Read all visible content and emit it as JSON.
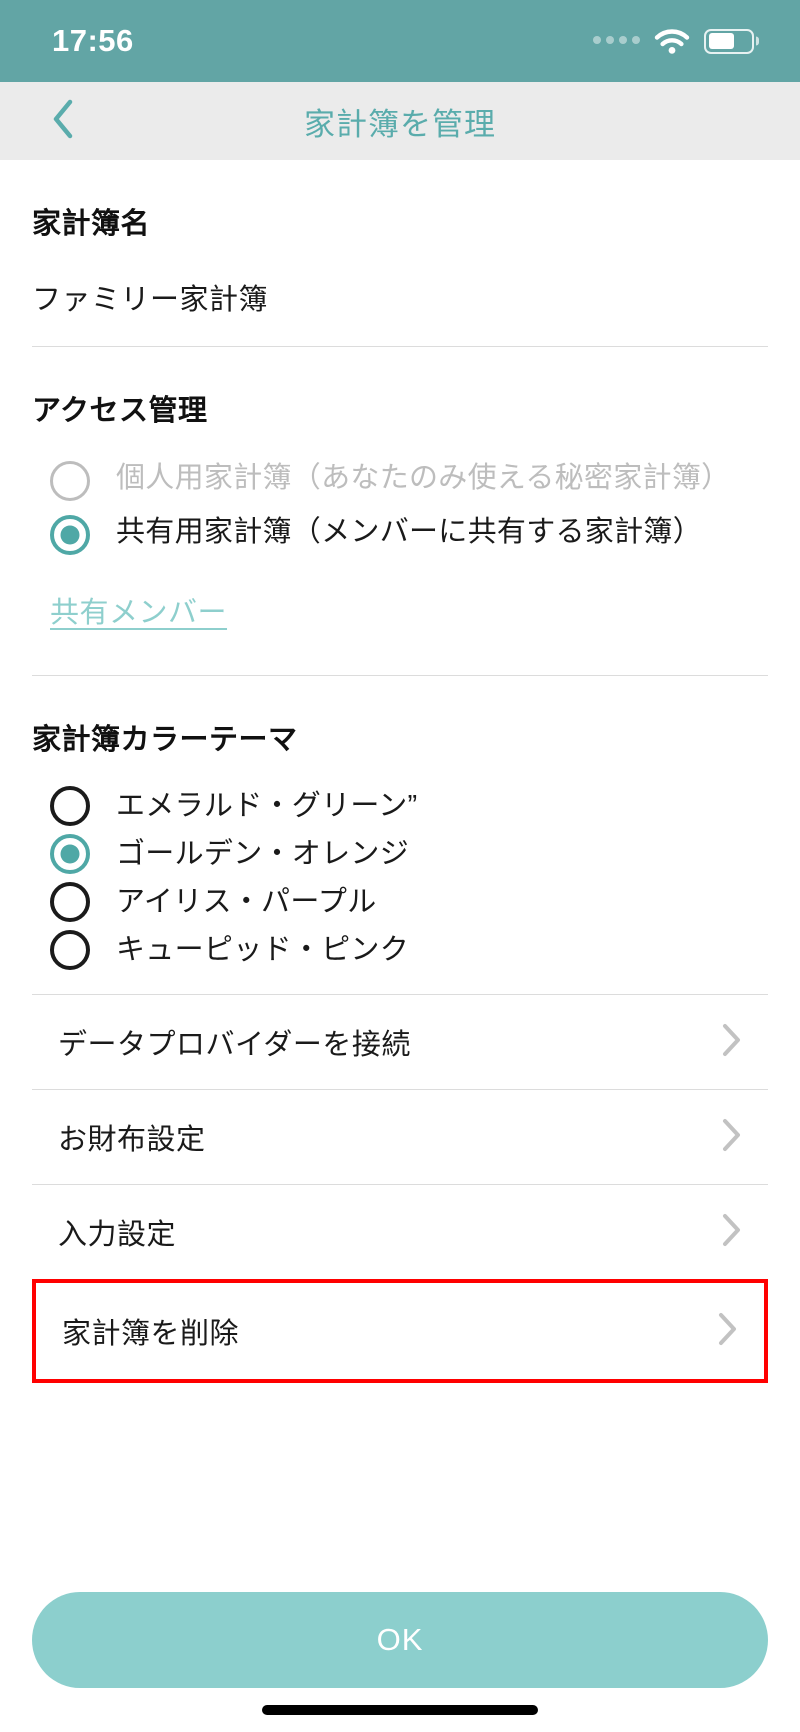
{
  "status_bar": {
    "time": "17:56",
    "signal_icon": "signal-dots-icon",
    "wifi_icon": "wifi-icon",
    "battery_icon": "battery-icon"
  },
  "nav": {
    "back_icon": "chevron-left-icon",
    "title": "家計簿を管理"
  },
  "name_section": {
    "label": "家計簿名",
    "value": "ファミリー家計簿"
  },
  "access_section": {
    "label": "アクセス管理",
    "options": [
      {
        "label": "個人用家計簿（あなたのみ使える秘密家計簿）",
        "selected": false,
        "disabled": true
      },
      {
        "label": "共有用家計簿（メンバーに共有する家計簿）",
        "selected": true,
        "disabled": false
      }
    ],
    "members_link": "共有メンバー"
  },
  "theme_section": {
    "label": "家計簿カラーテーマ",
    "options": [
      {
        "label": "エメラルド・グリーン”",
        "selected": false
      },
      {
        "label": "ゴールデン・オレンジ",
        "selected": true
      },
      {
        "label": "アイリス・パープル",
        "selected": false
      },
      {
        "label": "キューピッド・ピンク",
        "selected": false
      }
    ]
  },
  "list_rows": [
    {
      "label": "データプロバイダーを接続",
      "chevron": "chevron-right-icon",
      "highlighted": false
    },
    {
      "label": "お財布設定",
      "chevron": "chevron-right-icon",
      "highlighted": false
    },
    {
      "label": "入力設定",
      "chevron": "chevron-right-icon",
      "highlighted": false
    },
    {
      "label": "家計簿を削除",
      "chevron": "chevron-right-icon",
      "highlighted": true
    }
  ],
  "footer": {
    "ok_label": "OK"
  },
  "colors": {
    "status_bar_teal": "#62a5a5",
    "nav_bg": "#ebebeb",
    "nav_title_teal": "#5aacac",
    "accent_teal": "#4fa8a6",
    "link_teal": "#8ecfcd",
    "ok_button": "#8ccfcd",
    "danger_border": "#ff0000",
    "divider": "#dcdcdc",
    "disabled_grey": "#bdbdbd"
  }
}
